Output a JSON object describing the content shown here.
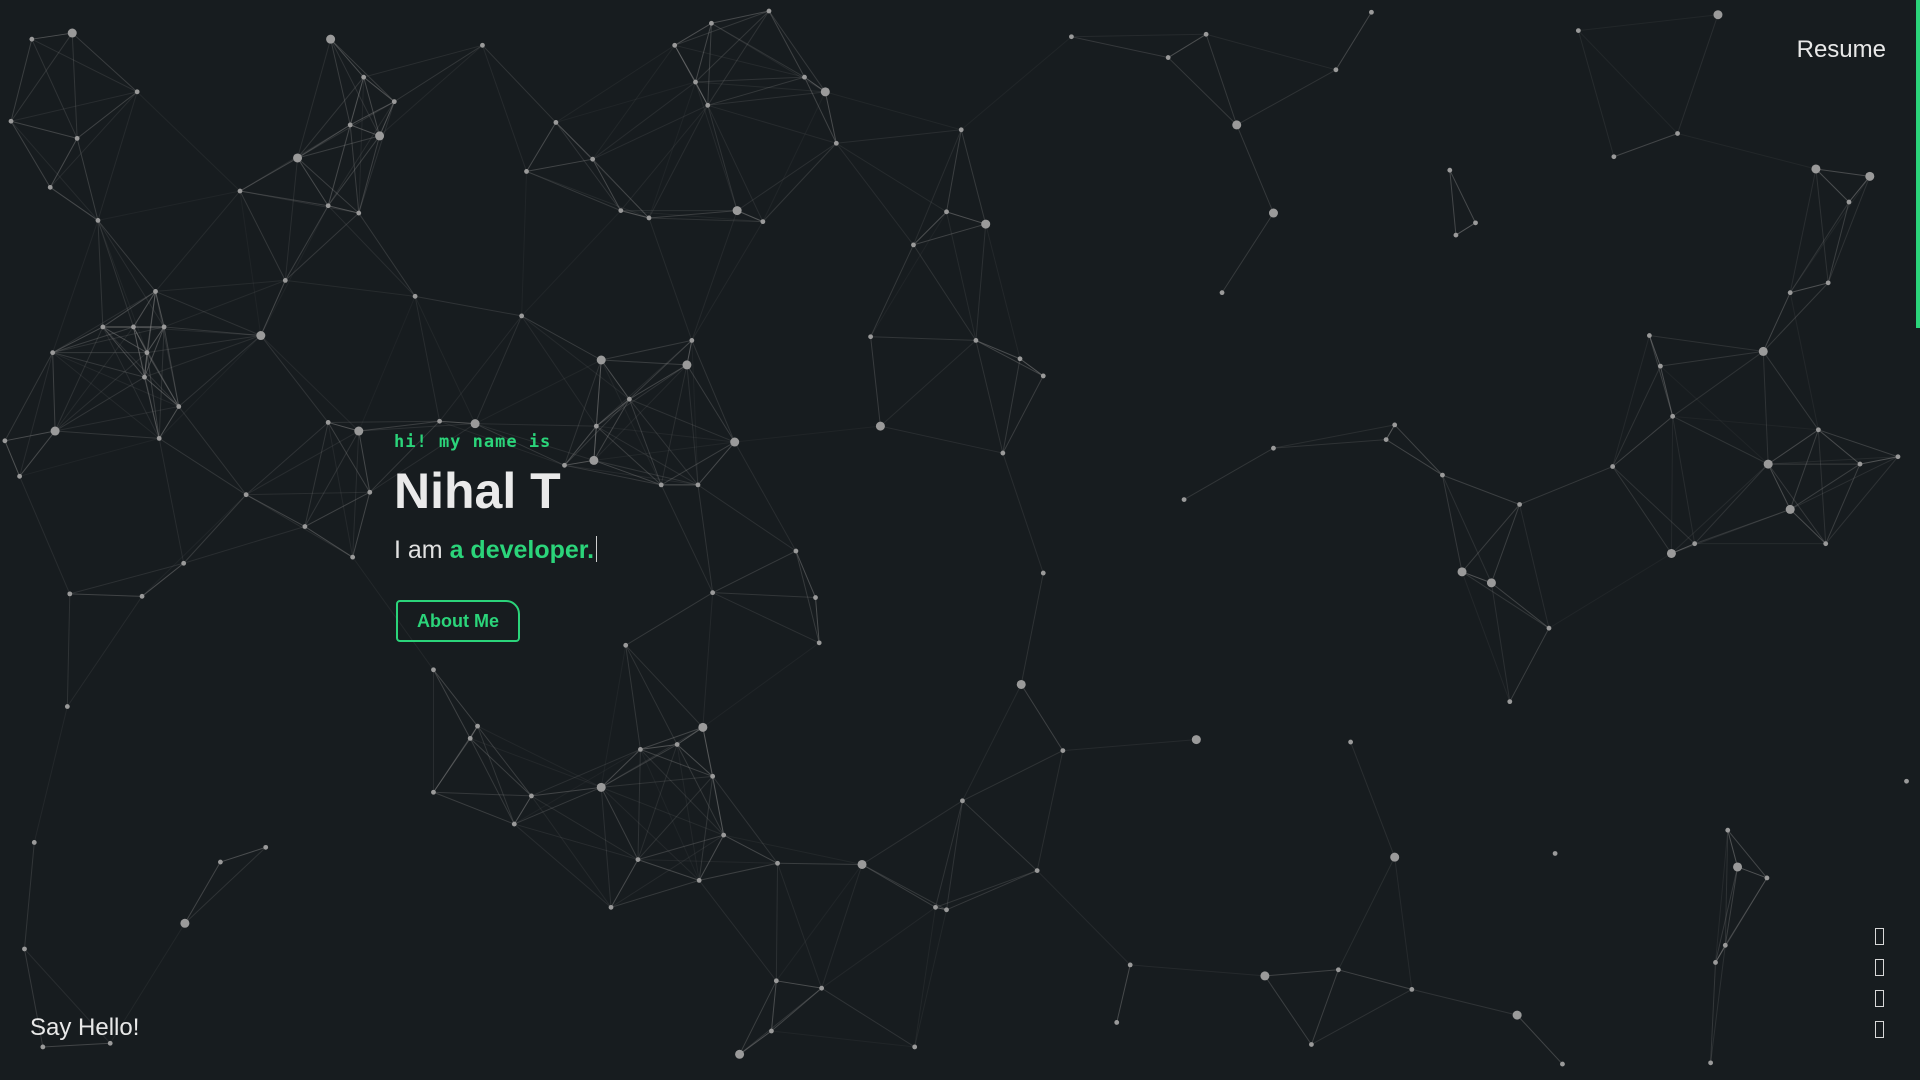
{
  "header": {
    "resume_label": "Resume"
  },
  "hero": {
    "greeting": "hi! my name is",
    "name": "Nihal T",
    "tagline_prefix": "I am ",
    "tagline_role": "a developer.",
    "cta_label": "About Me"
  },
  "footer": {
    "say_hello": "Say Hello!"
  },
  "social_links": [
    {
      "icon": "github-icon"
    },
    {
      "icon": "linkedin-icon"
    },
    {
      "icon": "twitter-icon"
    },
    {
      "icon": "instagram-icon"
    }
  ],
  "colors": {
    "background": "#171c1f",
    "accent": "#2bd47a",
    "text": "#e8e8e8",
    "particle": "#9a9a9a"
  }
}
